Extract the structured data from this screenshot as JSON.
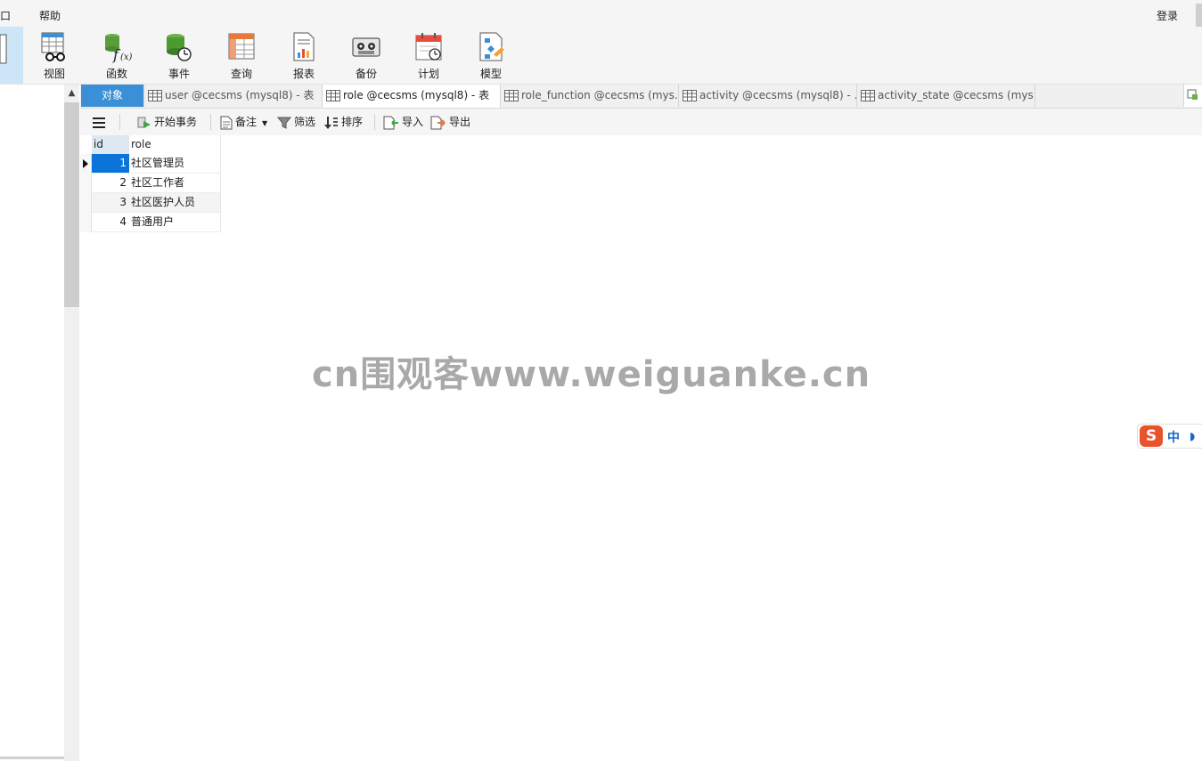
{
  "menubar": {
    "items": [
      "口",
      "帮助"
    ],
    "login": "登录"
  },
  "ribbon": {
    "buttons": [
      {
        "label": "视图",
        "icon": "view-icon"
      },
      {
        "label": "函数",
        "icon": "function-icon"
      },
      {
        "label": "事件",
        "icon": "event-icon"
      },
      {
        "label": "查询",
        "icon": "query-icon"
      },
      {
        "label": "报表",
        "icon": "report-icon"
      },
      {
        "label": "备份",
        "icon": "backup-icon"
      },
      {
        "label": "计划",
        "icon": "schedule-icon"
      },
      {
        "label": "模型",
        "icon": "model-icon"
      }
    ]
  },
  "tabs": [
    {
      "label": "对象",
      "icon": ""
    },
    {
      "label": "user @cecsms (mysql8) - 表",
      "icon": "table-icon"
    },
    {
      "label": "role @cecsms (mysql8) - 表",
      "icon": "table-icon"
    },
    {
      "label": "role_function @cecsms (mys...",
      "icon": "table-icon"
    },
    {
      "label": "activity @cecsms (mysql8) - ...",
      "icon": "table-icon"
    },
    {
      "label": "activity_state @cecsms (mys...",
      "icon": "table-icon"
    }
  ],
  "toolbar": {
    "begin_transaction": "开始事务",
    "memo": "备注",
    "filter": "筛选",
    "sort": "排序",
    "import": "导入",
    "export": "导出"
  },
  "grid": {
    "columns": [
      "id",
      "role"
    ],
    "rows": [
      {
        "id": "1",
        "role": "社区管理员"
      },
      {
        "id": "2",
        "role": "社区工作者"
      },
      {
        "id": "3",
        "role": "社区医护人员"
      },
      {
        "id": "4",
        "role": "普通用户"
      }
    ],
    "selected_row": 0
  },
  "watermark": "cn围观客www.weiguanke.cn",
  "ime": {
    "logo": "S",
    "mode": "中",
    "moon": "◗"
  },
  "colors": {
    "accent": "#3a8fd6",
    "selection": "#0a74da",
    "ime_brand": "#e9532b"
  }
}
